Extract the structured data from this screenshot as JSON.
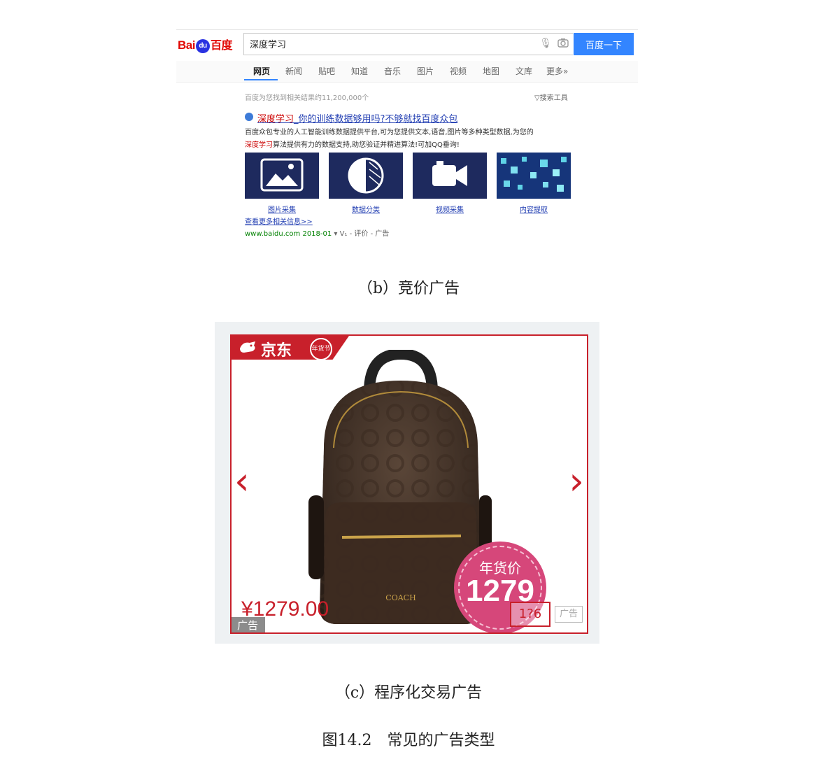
{
  "baidu": {
    "logo_bai": "Bai",
    "logo_du": "du",
    "logo_cn": "百度",
    "query": "深度学习",
    "search_button": "百度一下",
    "tabs": [
      "网页",
      "新闻",
      "贴吧",
      "知道",
      "音乐",
      "图片",
      "视频",
      "地图",
      "文库",
      "更多»"
    ],
    "result_count": "百度为您找到相关结果约11,200,000个",
    "search_tools": "▽搜索工具",
    "ad_title_keyword": "深度学习",
    "ad_title_rest": "_你的训练数据够用吗?不够就找百度众包",
    "desc_line1": "百度众包专业的人工智能训练数据提供平台,可为您提供文本,语音,图片等多种类型数据,为您的",
    "desc_keyword": "深度学习",
    "desc_line2_rest": "算法提供有力的数据支持,助您验证并精进算法!可加QQ垂询!",
    "tiles": [
      {
        "label": "图片采集",
        "icon": "image-icon"
      },
      {
        "label": "数据分类",
        "icon": "contrast-icon"
      },
      {
        "label": "视频采集",
        "icon": "video-camera-icon"
      },
      {
        "label": "内容提取",
        "icon": "pixel-blocks-icon"
      }
    ],
    "more_link": "查看更多相关信息>>",
    "url_line": "www.baidu.com  2018-01",
    "url_extra": " ▾ V₁ - 评价 - 广告"
  },
  "captions": {
    "b": "（b）竞价广告",
    "c": "（c）程序化交易广告",
    "figure": "图14.2　常见的广告类型"
  },
  "jd": {
    "brand": "京东",
    "seal": "年货节",
    "price": "¥1279.00",
    "ad_tag": "广告",
    "badge_label": "年货价",
    "badge_price": "1279",
    "small_price": "1?6",
    "small_ad": "广告",
    "bag_brand": "COACH",
    "colors": {
      "red": "#c8202b",
      "pink": "#d6477a",
      "baidu_blue": "#3385ff"
    }
  }
}
